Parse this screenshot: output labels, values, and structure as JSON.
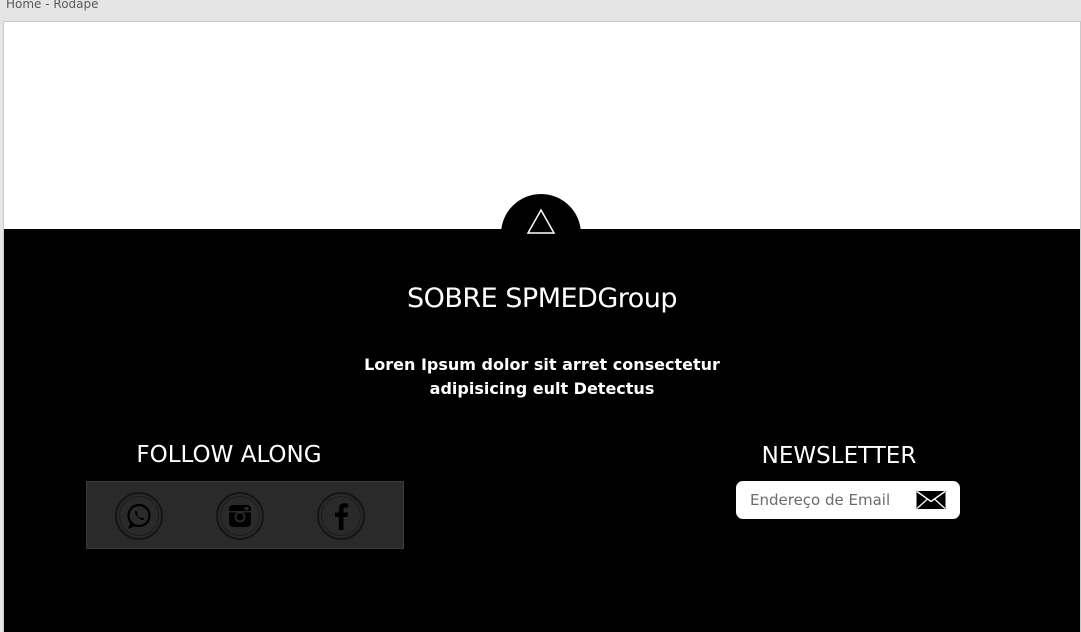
{
  "window": {
    "tab_label": "Home - Rodape"
  },
  "footer": {
    "about_title": "SOBRE SPMEDGroup",
    "about_text": "Loren Ipsum dolor sit arret consectetur adipisicing eult Detectus",
    "follow_title": "FOLLOW ALONG",
    "social_links": [
      {
        "name": "whatsapp",
        "icon": "whatsapp-icon"
      },
      {
        "name": "instagram",
        "icon": "instagram-icon"
      },
      {
        "name": "facebook",
        "icon": "facebook-icon"
      }
    ],
    "newsletter_title": "NEWSLETTER",
    "newsletter_placeholder": "Endereço de Email",
    "send_icon": "envelope-icon",
    "scroll_top_icon": "triangle-up-icon"
  },
  "colors": {
    "footer_bg": "#000000",
    "page_bg": "#ffffff",
    "canvas_bg": "#e5e5e5",
    "social_box_bg": "#2a2a2a",
    "text": "#ffffff"
  }
}
